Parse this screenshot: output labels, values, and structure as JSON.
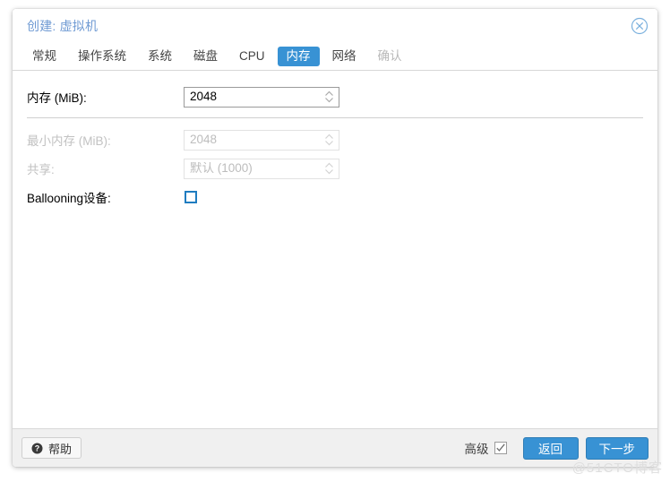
{
  "dialog": {
    "title": "创建: 虚拟机",
    "close_icon": "close-circle-icon"
  },
  "tabs": [
    {
      "label": "常规",
      "state": "normal"
    },
    {
      "label": "操作系统",
      "state": "normal"
    },
    {
      "label": "系统",
      "state": "normal"
    },
    {
      "label": "磁盘",
      "state": "normal"
    },
    {
      "label": "CPU",
      "state": "normal"
    },
    {
      "label": "内存",
      "state": "active"
    },
    {
      "label": "网络",
      "state": "normal"
    },
    {
      "label": "确认",
      "state": "disabled"
    }
  ],
  "form": {
    "memory": {
      "label": "内存 (MiB):",
      "value": "2048",
      "enabled": true,
      "spinner_icon": "spinner-updown-icon"
    },
    "min_memory": {
      "label": "最小内存 (MiB):",
      "value": "2048",
      "enabled": false,
      "spinner_icon": "spinner-updown-icon"
    },
    "shares": {
      "label": "共享:",
      "value": "默认 (1000)",
      "enabled": false,
      "spinner_icon": "spinner-updown-icon"
    },
    "ballooning": {
      "label": "Ballooning设备:",
      "checked": false,
      "checkbox_icon": "checkbox-unchecked-icon"
    }
  },
  "footer": {
    "help_label": "帮助",
    "help_icon": "question-circle-icon",
    "advanced_label": "高级",
    "advanced_checked": true,
    "advanced_icon": "checkbox-checked-icon",
    "back_label": "返回",
    "next_label": "下一步"
  },
  "watermark": "@51CTO博客",
  "colors": {
    "accent": "#3892d4",
    "title": "#6f9ad3",
    "checkbox_blue": "#1f7cc0",
    "footer_bg": "#f0f0f0",
    "disabled_text": "#c2c2c2"
  }
}
